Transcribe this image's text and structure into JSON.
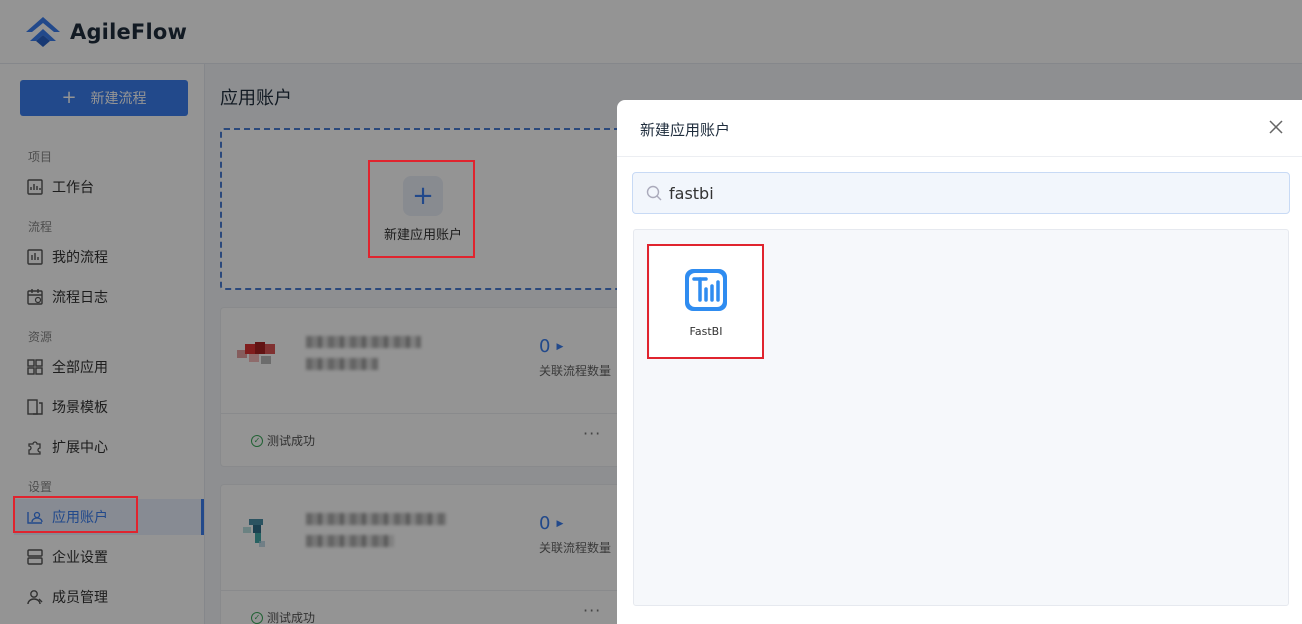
{
  "app": {
    "name": "AgileFlow",
    "accent": "#3b7ef0"
  },
  "sidebar": {
    "new_flow_button": "新建流程",
    "sections": {
      "project": "项目",
      "flow": "流程",
      "resource": "资源",
      "settings": "设置"
    },
    "items": [
      {
        "label": "工作台",
        "icon": "dashboard-icon"
      },
      {
        "label": "我的流程",
        "icon": "chart-icon"
      },
      {
        "label": "流程日志",
        "icon": "calendar-icon"
      },
      {
        "label": "全部应用",
        "icon": "grid-icon"
      },
      {
        "label": "场景模板",
        "icon": "template-icon"
      },
      {
        "label": "扩展中心",
        "icon": "puzzle-icon"
      },
      {
        "label": "应用账户",
        "icon": "account-icon",
        "active": true
      },
      {
        "label": "企业设置",
        "icon": "enterprise-icon"
      },
      {
        "label": "成员管理",
        "icon": "member-icon"
      }
    ]
  },
  "main": {
    "title": "应用账户",
    "new_account_label": "新建应用账户",
    "cards": [
      {
        "flow_count": "0",
        "flow_count_label": "关联流程数量",
        "status": "测试成功",
        "more": "···"
      },
      {
        "flow_count": "0",
        "flow_count_label": "关联流程数量",
        "status": "测试成功",
        "more": "···"
      }
    ]
  },
  "modal": {
    "title": "新建应用账户",
    "search_value": "fastbi",
    "results": [
      {
        "label": "FastBI",
        "icon": "fastbi-icon"
      }
    ]
  }
}
